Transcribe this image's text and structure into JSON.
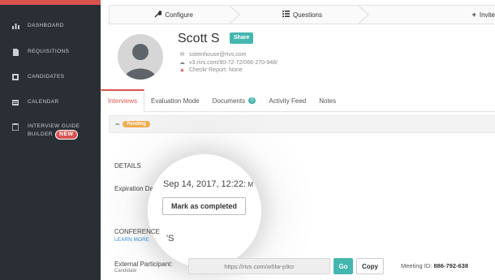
{
  "sidebar": {
    "items": [
      {
        "label": "DASHBOARD",
        "icon": "bar-chart-icon"
      },
      {
        "label": "REQUISITIONS",
        "icon": "document-icon"
      },
      {
        "label": "CANDIDATES",
        "icon": "id-card-icon"
      },
      {
        "label": "CALENDAR",
        "icon": "calendar-icon"
      },
      {
        "label": "INTERVIEW GUIDE",
        "label2": "BUILDER",
        "icon": "clipboard-icon",
        "badge": "NEW"
      }
    ]
  },
  "steps": [
    {
      "label": "Configure",
      "icon": "wrench-icon"
    },
    {
      "label": "Questions",
      "icon": "list-icon"
    },
    {
      "label": "Invite",
      "icon": "plus-icon"
    }
  ],
  "candidate": {
    "name": "Scott S",
    "share_label": "Share",
    "email": "ssteinhouse@rivs.com",
    "link": "v3.rivs.com/80-72-72/066-270-948/",
    "checkr": "Checkr Report: None"
  },
  "tabs": [
    {
      "label": "Interviews",
      "active": true
    },
    {
      "label": "Evaluation Mode"
    },
    {
      "label": "Documents",
      "count": "0"
    },
    {
      "label": "Activity Feed"
    },
    {
      "label": "Notes"
    }
  ],
  "status": {
    "collapse": "−",
    "badge": "Pending"
  },
  "details": {
    "heading": "DETAILS",
    "expiration_label": "Expiration Dat",
    "expiration_value": "Sep 14, 2017, 12:22:",
    "expiration_tail": "M",
    "mark_completed_label": "Mark as completed"
  },
  "conference": {
    "heading": "CONFERENCE",
    "learn_more": "LEARN MORE",
    "fragment": "'S"
  },
  "external": {
    "label": "External Participant:",
    "sublabel": "Candidate",
    "url": "https://rivs.com/w5lw-p9cr",
    "go_label": "Go",
    "copy_label": "Copy",
    "meeting_label": "Meeting ID:",
    "meeting_id": "886-792-638"
  },
  "colors": {
    "accent": "#d9534f",
    "teal": "#45b6af",
    "sidebar": "#2a2f36",
    "pending": "#f0ad4e"
  }
}
